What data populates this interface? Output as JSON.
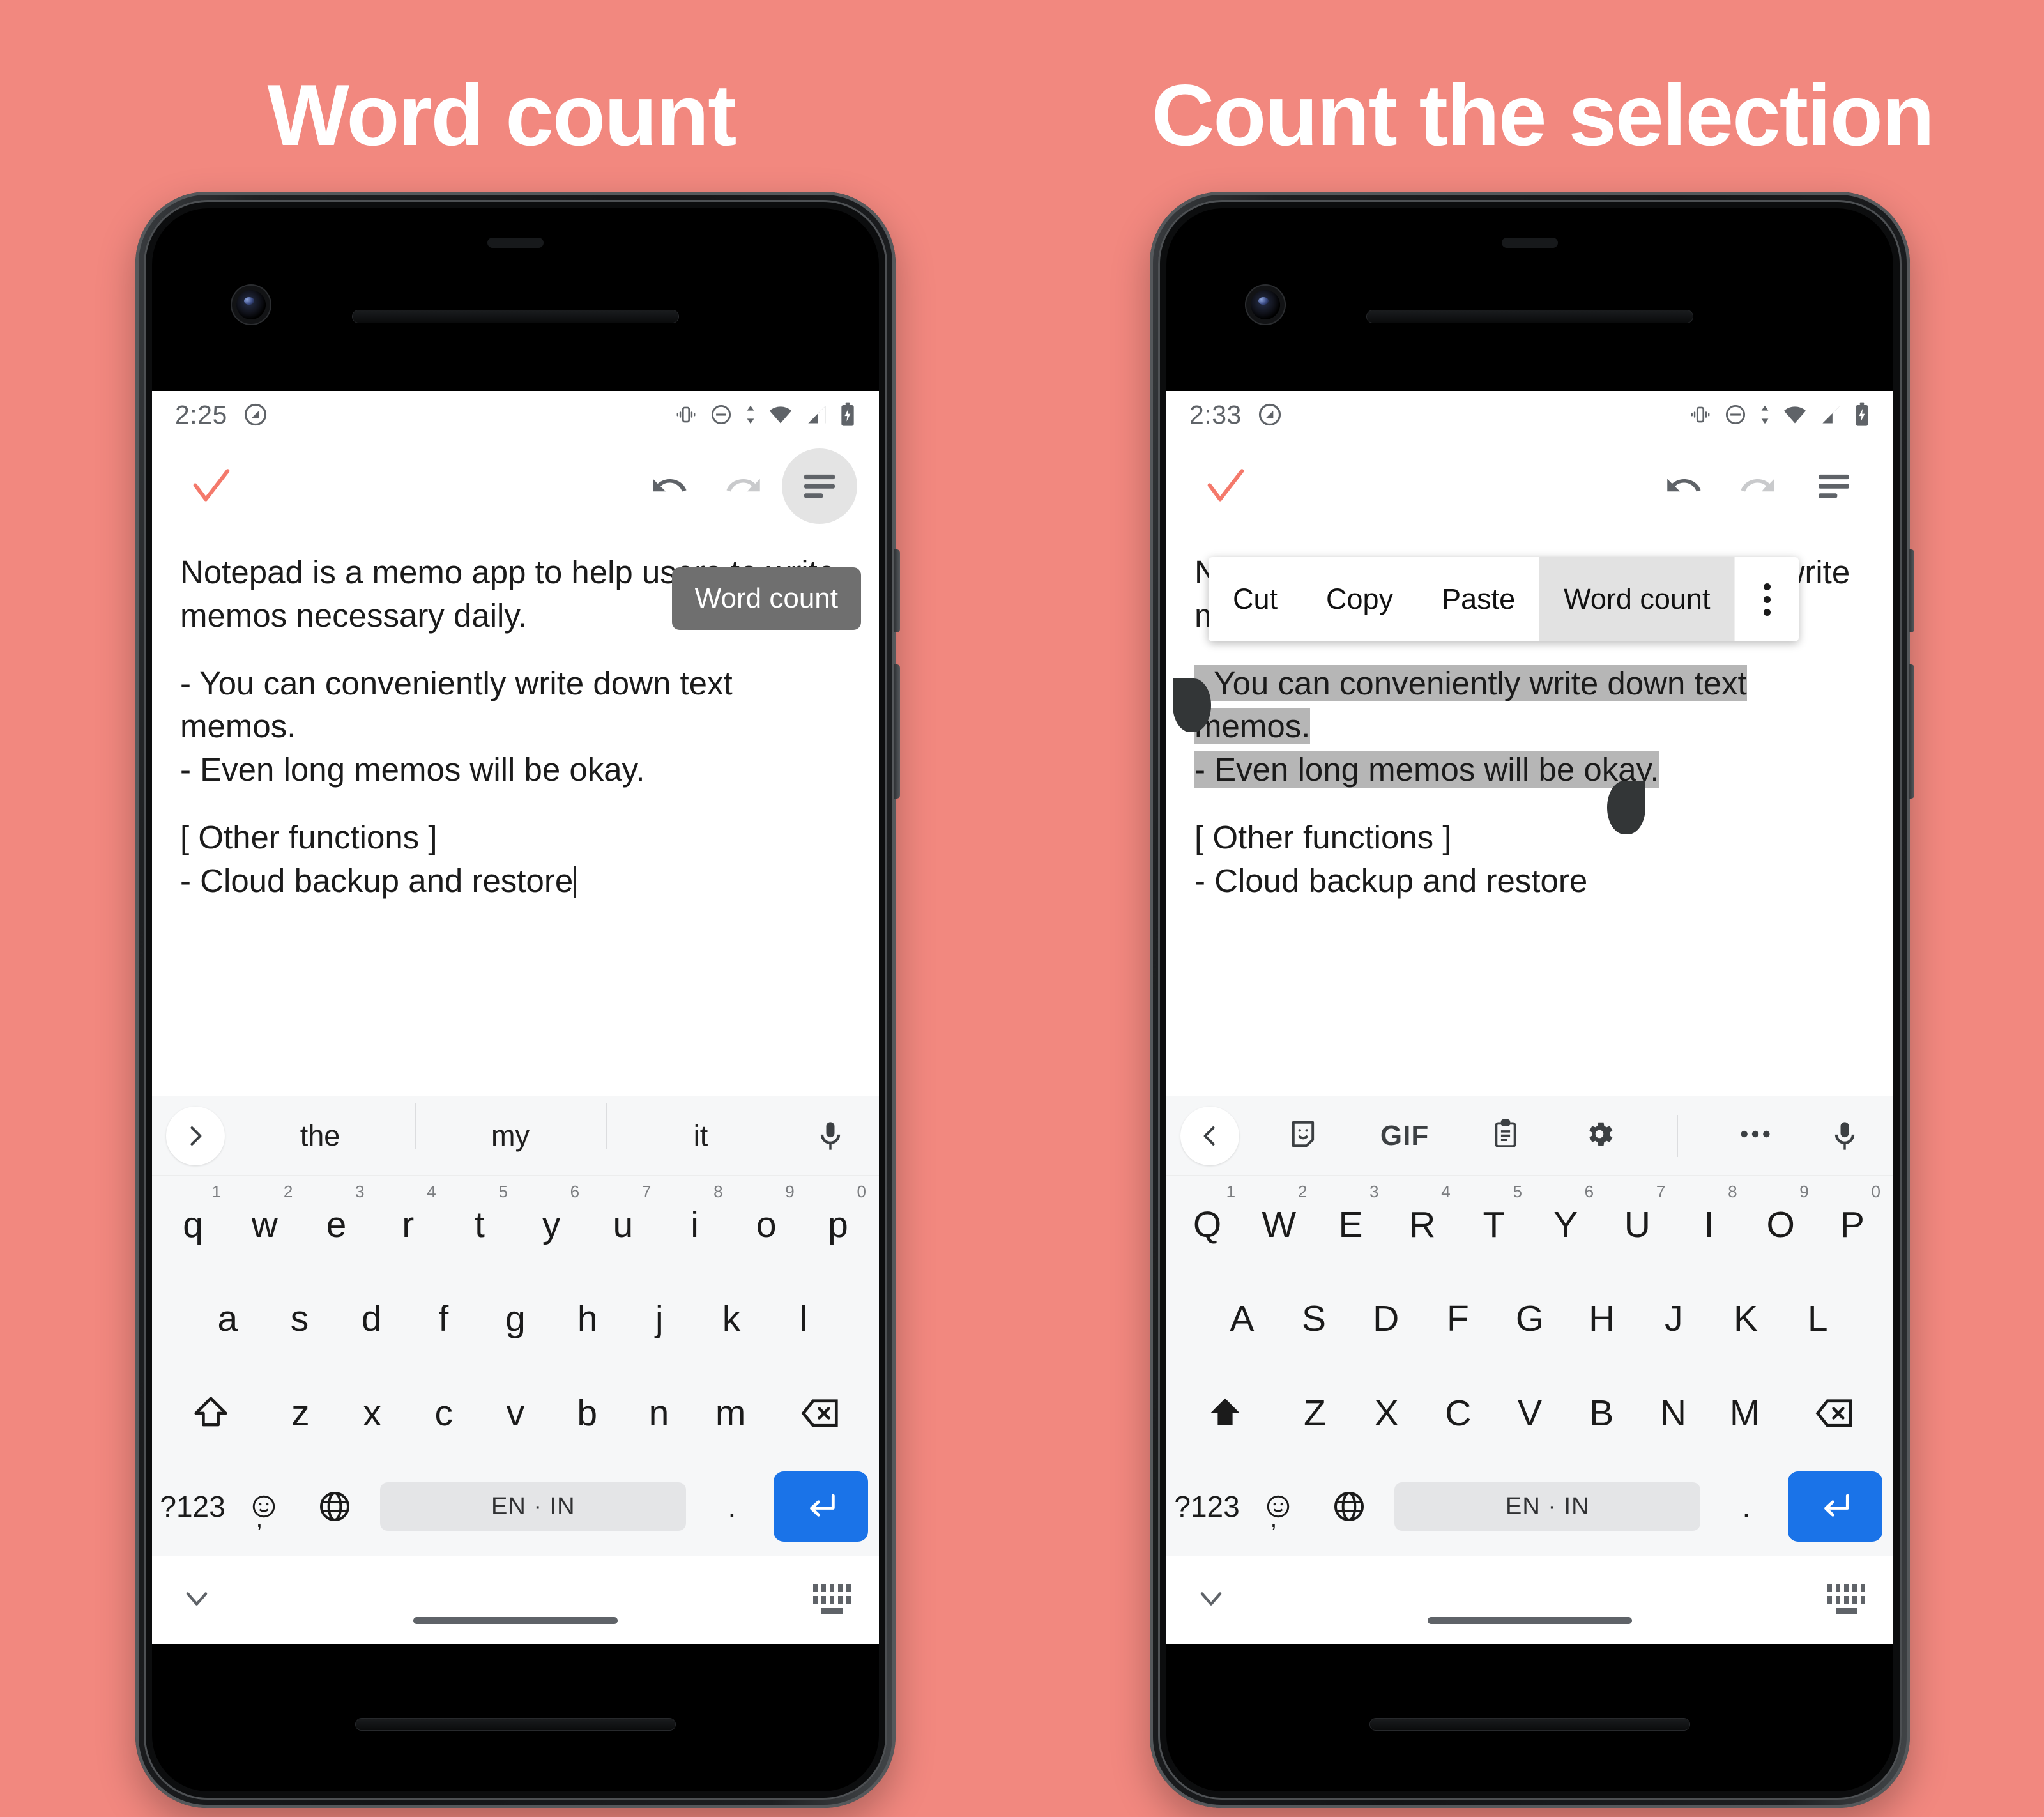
{
  "background_color": "#f2887f",
  "panels": [
    {
      "id": "left",
      "title": "Word count",
      "status": {
        "time": "2:25",
        "icons": [
          "android-q-icon",
          "vibrate-icon",
          "do-not-disturb-icon",
          "data-transfer-icon",
          "wifi-icon",
          "signal-icon",
          "battery-charging-icon"
        ]
      },
      "toolbar": {
        "confirm_label": "check-icon",
        "undo_label": "undo-icon",
        "redo_label": "redo-icon",
        "menu_label": "word-count-menu-icon",
        "menu_highlighted": true,
        "accent_color": "#f4796b"
      },
      "note": {
        "line1": "Notepad is a memo app to help users to write",
        "line2": "memos necessary daily.",
        "line3": "- You can conveniently write down text",
        "line4": "memos.",
        "line5": "- Even long memos will be okay.",
        "line6": "[ Other functions ]",
        "line7": "- Cloud backup and restore",
        "caret_after": "- Cloud backup and restore"
      },
      "tooltip": {
        "visible": true,
        "label": "Word count",
        "bg": "#6f6f6f"
      },
      "context_menu": {
        "visible": false
      },
      "keyboard": {
        "mode": "suggestions",
        "expand_icon": "chevron-right-icon",
        "suggestions": [
          "the",
          "my",
          "it"
        ],
        "mic_icon": "microphone-icon",
        "row1": [
          "q",
          "w",
          "e",
          "r",
          "t",
          "y",
          "u",
          "i",
          "o",
          "p"
        ],
        "row1_numbers": [
          "1",
          "2",
          "3",
          "4",
          "5",
          "6",
          "7",
          "8",
          "9",
          "0"
        ],
        "row2": [
          "a",
          "s",
          "d",
          "f",
          "g",
          "h",
          "j",
          "k",
          "l"
        ],
        "row3": [
          "z",
          "x",
          "c",
          "v",
          "b",
          "n",
          "m"
        ],
        "shift_icon": "shift-outline-icon",
        "backspace_icon": "backspace-icon",
        "symbols_label": "?123",
        "emoji_icon": "emoji-icon",
        "comma_label": ",",
        "globe_icon": "globe-icon",
        "space_label": "EN · IN",
        "period_label": ".",
        "enter_icon": "enter-icon",
        "enter_color": "#1a73e8"
      },
      "navbar": {
        "hide_keyboard_icon": "chevron-down-icon",
        "keyboard_switch_icon": "keyboard-switch-icon",
        "home_indicator": "home-gesture-bar"
      }
    },
    {
      "id": "right",
      "title": "Count the selection",
      "status": {
        "time": "2:33",
        "icons": [
          "android-q-icon",
          "vibrate-icon",
          "do-not-disturb-icon",
          "data-transfer-icon",
          "wifi-icon",
          "signal-icon",
          "battery-charging-icon"
        ]
      },
      "toolbar": {
        "confirm_label": "check-icon",
        "undo_label": "undo-icon",
        "redo_label": "redo-icon",
        "menu_label": "word-count-menu-icon",
        "menu_highlighted": false,
        "accent_color": "#f4796b"
      },
      "note": {
        "line1": "Notepad is a memo app to help users to write",
        "line2": "memos necessary daily.",
        "line3": "- You can conveniently write down text",
        "line4": "memos.",
        "line5": "- Even long memos will be okay.",
        "line6": "[ Other functions ]",
        "line7": "- Cloud backup and restore",
        "selection": {
          "active": true,
          "color": "#b6b6b6",
          "handle_color": "#333637",
          "selected_text": "- You can conveniently write down text memos.\n- Even long memos will be okay."
        }
      },
      "tooltip": {
        "visible": false
      },
      "context_menu": {
        "visible": true,
        "items": [
          "Cut",
          "Copy",
          "Paste",
          "Word count"
        ],
        "active_item": "Word count",
        "overflow_icon": "more-vertical-icon"
      },
      "keyboard": {
        "mode": "toolbar",
        "collapse_icon": "chevron-left-icon",
        "toolbar_icons": [
          "sticker-icon",
          "gif-icon",
          "clipboard-icon",
          "settings-gear-icon",
          "more-horizontal-icon",
          "microphone-icon"
        ],
        "gif_label": "GIF",
        "row1": [
          "Q",
          "W",
          "E",
          "R",
          "T",
          "Y",
          "U",
          "I",
          "O",
          "P"
        ],
        "row1_numbers": [
          "1",
          "2",
          "3",
          "4",
          "5",
          "6",
          "7",
          "8",
          "9",
          "0"
        ],
        "row2": [
          "A",
          "S",
          "D",
          "F",
          "G",
          "H",
          "J",
          "K",
          "L"
        ],
        "row3": [
          "Z",
          "X",
          "C",
          "V",
          "B",
          "N",
          "M"
        ],
        "shift_icon": "shift-filled-icon",
        "backspace_icon": "backspace-icon",
        "symbols_label": "?123",
        "emoji_icon": "emoji-icon",
        "comma_label": ",",
        "globe_icon": "globe-icon",
        "space_label": "EN · IN",
        "period_label": ".",
        "enter_icon": "enter-icon",
        "enter_color": "#1a73e8"
      },
      "navbar": {
        "hide_keyboard_icon": "chevron-down-icon",
        "keyboard_switch_icon": "keyboard-switch-icon",
        "home_indicator": "home-gesture-bar"
      }
    }
  ]
}
